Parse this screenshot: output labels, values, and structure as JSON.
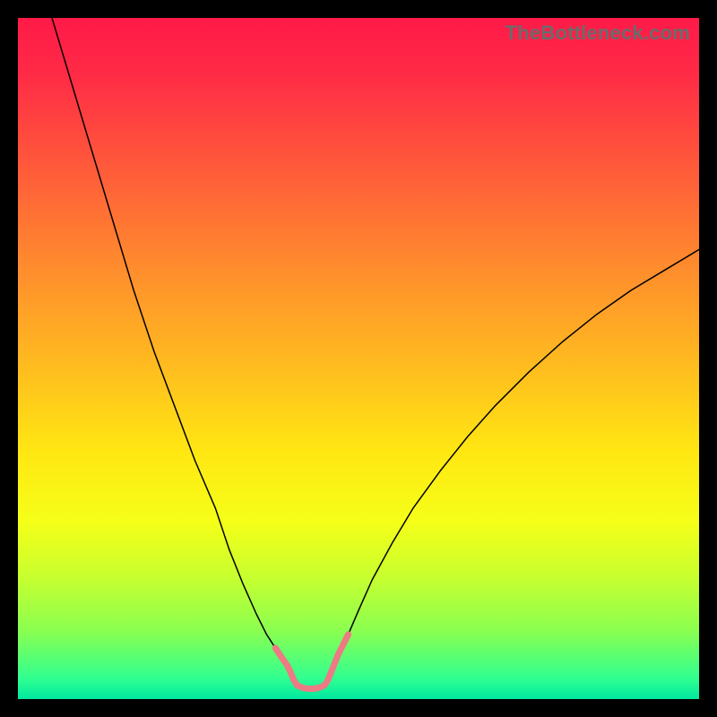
{
  "watermark": "TheBottleneck.com",
  "chart_data": {
    "type": "line",
    "title": "",
    "xlabel": "",
    "ylabel": "",
    "xlim": [
      0,
      100
    ],
    "ylim": [
      0,
      100
    ],
    "grid": false,
    "legend": false,
    "annotations": [],
    "series": [
      {
        "name": "left-curve",
        "color": "#000000",
        "width": 1.5,
        "x": [
          5,
          8,
          11,
          14,
          17,
          20,
          23,
          26,
          29,
          31,
          33,
          35,
          36.5,
          37.8,
          38.8,
          39.5,
          40,
          40.5
        ],
        "y": [
          100,
          90,
          80,
          70,
          60,
          51,
          43,
          35,
          28,
          22,
          17,
          12.5,
          9.5,
          7.5,
          6.0,
          5.0,
          4.0,
          2.8
        ]
      },
      {
        "name": "right-curve",
        "color": "#000000",
        "width": 1.5,
        "x": [
          45.5,
          46,
          47,
          48.5,
          50,
          52,
          55,
          58,
          62,
          66,
          70,
          75,
          80,
          85,
          90,
          95,
          100
        ],
        "y": [
          2.8,
          4.0,
          6.5,
          9.5,
          13,
          17.5,
          23,
          28,
          33.5,
          38.5,
          43,
          48,
          52.5,
          56.5,
          60,
          63,
          66
        ]
      },
      {
        "name": "bottom-pink-segment",
        "color": "#ED7A84",
        "width": 7,
        "x": [
          37.8,
          38.8,
          39.5,
          40,
          40.5,
          41,
          42,
          43,
          44,
          45,
          45.5,
          46,
          47,
          48.5
        ],
        "y": [
          7.5,
          6.0,
          5.0,
          4.0,
          2.8,
          2.0,
          1.6,
          1.5,
          1.6,
          2.0,
          2.8,
          4.0,
          6.5,
          9.5
        ]
      }
    ]
  }
}
